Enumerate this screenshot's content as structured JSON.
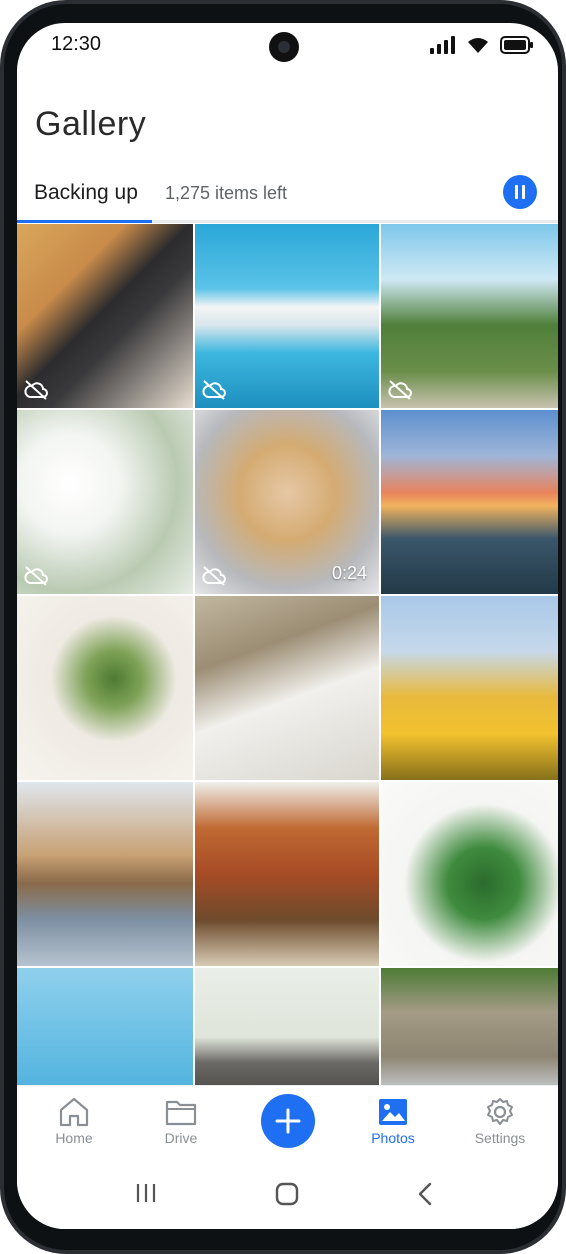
{
  "status_bar": {
    "time": "12:30"
  },
  "header": {
    "title": "Gallery"
  },
  "backup": {
    "label": "Backing up",
    "count": "1,275 items left",
    "progress": 0.5
  },
  "photos": [
    {
      "id": 1,
      "cloud_off": true
    },
    {
      "id": 2,
      "cloud_off": true
    },
    {
      "id": 3,
      "cloud_off": true
    },
    {
      "id": 4,
      "cloud_off": true
    },
    {
      "id": 5,
      "cloud_off": true,
      "duration": "0:24"
    },
    {
      "id": 6,
      "cloud_off": false
    },
    {
      "id": 7,
      "cloud_off": false
    },
    {
      "id": 8,
      "cloud_off": false
    },
    {
      "id": 9,
      "cloud_off": false
    },
    {
      "id": 10,
      "cloud_off": false
    },
    {
      "id": 11,
      "cloud_off": false
    },
    {
      "id": 12,
      "cloud_off": false
    },
    {
      "id": 13,
      "cloud_off": false
    },
    {
      "id": 14,
      "cloud_off": false
    },
    {
      "id": 15,
      "cloud_off": false
    }
  ],
  "bottom_nav": {
    "home": "Home",
    "drive": "Drive",
    "photos": "Photos",
    "settings": "Settings",
    "active": "photos"
  },
  "colors": {
    "accent": "#1e6ff1",
    "inactive": "#8a8f96"
  }
}
